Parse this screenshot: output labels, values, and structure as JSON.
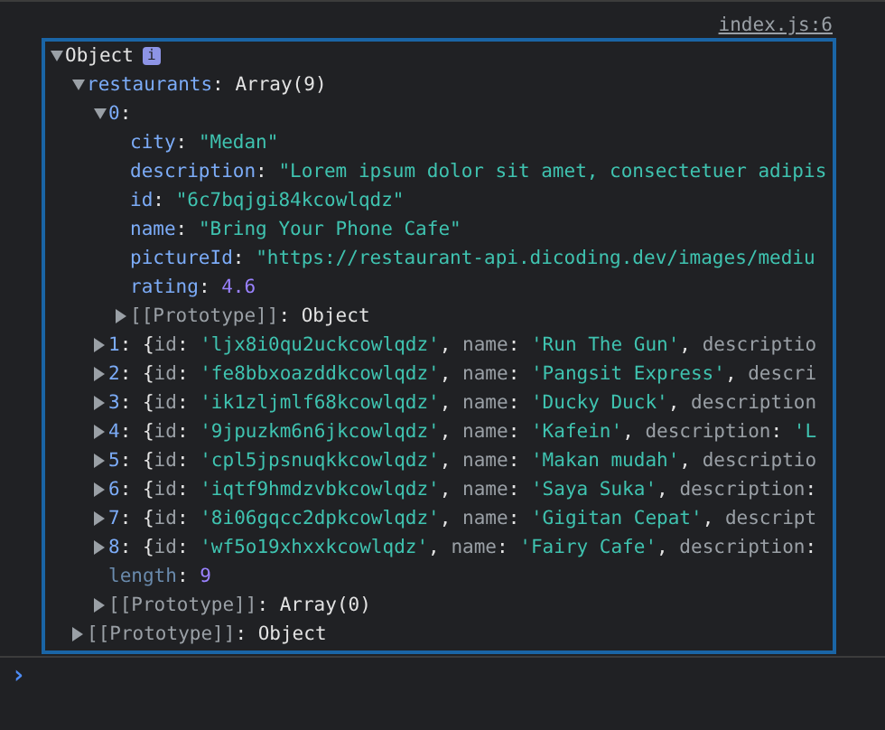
{
  "source_link": "index.js:6",
  "tree": {
    "expanded": true,
    "tokens": [
      {
        "kind": "type",
        "text": "Object"
      }
    ],
    "info_badge": "i",
    "children": [
      {
        "expanded": true,
        "tokens": [
          {
            "kind": "key",
            "text": "restaurants"
          },
          {
            "kind": "punct",
            "text": ": "
          },
          {
            "kind": "type",
            "text": "Array(9)"
          }
        ],
        "children": [
          {
            "expanded": true,
            "tokens": [
              {
                "kind": "key",
                "text": "0"
              },
              {
                "kind": "punct",
                "text": ":"
              }
            ],
            "children": [
              {
                "tokens": [
                  {
                    "kind": "key",
                    "text": "city"
                  },
                  {
                    "kind": "punct",
                    "text": ": "
                  },
                  {
                    "kind": "string",
                    "text": "\"Medan\""
                  }
                ]
              },
              {
                "tokens": [
                  {
                    "kind": "key",
                    "text": "description"
                  },
                  {
                    "kind": "punct",
                    "text": ": "
                  },
                  {
                    "kind": "string",
                    "text": "\"Lorem ipsum dolor sit amet, consectetuer adipis"
                  }
                ]
              },
              {
                "tokens": [
                  {
                    "kind": "key",
                    "text": "id"
                  },
                  {
                    "kind": "punct",
                    "text": ": "
                  },
                  {
                    "kind": "string",
                    "text": "\"6c7bqjgi84kcowlqdz\""
                  }
                ]
              },
              {
                "tokens": [
                  {
                    "kind": "key",
                    "text": "name"
                  },
                  {
                    "kind": "punct",
                    "text": ": "
                  },
                  {
                    "kind": "string",
                    "text": "\"Bring Your Phone Cafe\""
                  }
                ]
              },
              {
                "tokens": [
                  {
                    "kind": "key",
                    "text": "pictureId"
                  },
                  {
                    "kind": "punct",
                    "text": ": "
                  },
                  {
                    "kind": "string",
                    "text": "\"https://restaurant-api.dicoding.dev/images/mediu"
                  }
                ]
              },
              {
                "tokens": [
                  {
                    "kind": "key",
                    "text": "rating"
                  },
                  {
                    "kind": "punct",
                    "text": ": "
                  },
                  {
                    "kind": "number",
                    "text": "4.6"
                  }
                ]
              },
              {
                "expanded": false,
                "tokens": [
                  {
                    "kind": "internal",
                    "text": "[[Prototype]]"
                  },
                  {
                    "kind": "punct",
                    "text": ": "
                  },
                  {
                    "kind": "type",
                    "text": "Object"
                  }
                ]
              }
            ]
          },
          {
            "expanded": false,
            "tokens": [
              {
                "kind": "key",
                "text": "1"
              },
              {
                "kind": "punct",
                "text": ": {"
              },
              {
                "kind": "preview_key",
                "text": "id"
              },
              {
                "kind": "punct",
                "text": ": "
              },
              {
                "kind": "string",
                "text": "'ljx8i0qu2uckcowlqdz'"
              },
              {
                "kind": "punct",
                "text": ", "
              },
              {
                "kind": "preview_key",
                "text": "name"
              },
              {
                "kind": "punct",
                "text": ": "
              },
              {
                "kind": "string",
                "text": "'Run The Gun'"
              },
              {
                "kind": "punct",
                "text": ", "
              },
              {
                "kind": "preview_key",
                "text": "descriptio"
              }
            ]
          },
          {
            "expanded": false,
            "tokens": [
              {
                "kind": "key",
                "text": "2"
              },
              {
                "kind": "punct",
                "text": ": {"
              },
              {
                "kind": "preview_key",
                "text": "id"
              },
              {
                "kind": "punct",
                "text": ": "
              },
              {
                "kind": "string",
                "text": "'fe8bbxoazddkcowlqdz'"
              },
              {
                "kind": "punct",
                "text": ", "
              },
              {
                "kind": "preview_key",
                "text": "name"
              },
              {
                "kind": "punct",
                "text": ": "
              },
              {
                "kind": "string",
                "text": "'Pangsit Express'"
              },
              {
                "kind": "punct",
                "text": ", "
              },
              {
                "kind": "preview_key",
                "text": "descri"
              }
            ]
          },
          {
            "expanded": false,
            "tokens": [
              {
                "kind": "key",
                "text": "3"
              },
              {
                "kind": "punct",
                "text": ": {"
              },
              {
                "kind": "preview_key",
                "text": "id"
              },
              {
                "kind": "punct",
                "text": ": "
              },
              {
                "kind": "string",
                "text": "'ik1zljmlf68kcowlqdz'"
              },
              {
                "kind": "punct",
                "text": ", "
              },
              {
                "kind": "preview_key",
                "text": "name"
              },
              {
                "kind": "punct",
                "text": ": "
              },
              {
                "kind": "string",
                "text": "'Ducky Duck'"
              },
              {
                "kind": "punct",
                "text": ", "
              },
              {
                "kind": "preview_key",
                "text": "description"
              }
            ]
          },
          {
            "expanded": false,
            "tokens": [
              {
                "kind": "key",
                "text": "4"
              },
              {
                "kind": "punct",
                "text": ": {"
              },
              {
                "kind": "preview_key",
                "text": "id"
              },
              {
                "kind": "punct",
                "text": ": "
              },
              {
                "kind": "string",
                "text": "'9jpuzkm6n6jkcowlqdz'"
              },
              {
                "kind": "punct",
                "text": ", "
              },
              {
                "kind": "preview_key",
                "text": "name"
              },
              {
                "kind": "punct",
                "text": ": "
              },
              {
                "kind": "string",
                "text": "'Kafein'"
              },
              {
                "kind": "punct",
                "text": ", "
              },
              {
                "kind": "preview_key",
                "text": "description"
              },
              {
                "kind": "punct",
                "text": ": "
              },
              {
                "kind": "string",
                "text": "'L"
              }
            ]
          },
          {
            "expanded": false,
            "tokens": [
              {
                "kind": "key",
                "text": "5"
              },
              {
                "kind": "punct",
                "text": ": {"
              },
              {
                "kind": "preview_key",
                "text": "id"
              },
              {
                "kind": "punct",
                "text": ": "
              },
              {
                "kind": "string",
                "text": "'cpl5jpsnuqkkcowlqdz'"
              },
              {
                "kind": "punct",
                "text": ", "
              },
              {
                "kind": "preview_key",
                "text": "name"
              },
              {
                "kind": "punct",
                "text": ": "
              },
              {
                "kind": "string",
                "text": "'Makan mudah'"
              },
              {
                "kind": "punct",
                "text": ", "
              },
              {
                "kind": "preview_key",
                "text": "descriptio"
              }
            ]
          },
          {
            "expanded": false,
            "tokens": [
              {
                "kind": "key",
                "text": "6"
              },
              {
                "kind": "punct",
                "text": ": {"
              },
              {
                "kind": "preview_key",
                "text": "id"
              },
              {
                "kind": "punct",
                "text": ": "
              },
              {
                "kind": "string",
                "text": "'iqtf9hmdzvbkcowlqdz'"
              },
              {
                "kind": "punct",
                "text": ", "
              },
              {
                "kind": "preview_key",
                "text": "name"
              },
              {
                "kind": "punct",
                "text": ": "
              },
              {
                "kind": "string",
                "text": "'Saya Suka'"
              },
              {
                "kind": "punct",
                "text": ", "
              },
              {
                "kind": "preview_key",
                "text": "description"
              },
              {
                "kind": "punct",
                "text": ":"
              }
            ]
          },
          {
            "expanded": false,
            "tokens": [
              {
                "kind": "key",
                "text": "7"
              },
              {
                "kind": "punct",
                "text": ": {"
              },
              {
                "kind": "preview_key",
                "text": "id"
              },
              {
                "kind": "punct",
                "text": ": "
              },
              {
                "kind": "string",
                "text": "'8i06gqcc2dpkcowlqdz'"
              },
              {
                "kind": "punct",
                "text": ", "
              },
              {
                "kind": "preview_key",
                "text": "name"
              },
              {
                "kind": "punct",
                "text": ": "
              },
              {
                "kind": "string",
                "text": "'Gigitan Cepat'"
              },
              {
                "kind": "punct",
                "text": ", "
              },
              {
                "kind": "preview_key",
                "text": "descript"
              }
            ]
          },
          {
            "expanded": false,
            "tokens": [
              {
                "kind": "key",
                "text": "8"
              },
              {
                "kind": "punct",
                "text": ": {"
              },
              {
                "kind": "preview_key",
                "text": "id"
              },
              {
                "kind": "punct",
                "text": ": "
              },
              {
                "kind": "string",
                "text": "'wf5o19xhxxkcowlqdz'"
              },
              {
                "kind": "punct",
                "text": ", "
              },
              {
                "kind": "preview_key",
                "text": "name"
              },
              {
                "kind": "punct",
                "text": ": "
              },
              {
                "kind": "string",
                "text": "'Fairy Cafe'"
              },
              {
                "kind": "punct",
                "text": ", "
              },
              {
                "kind": "preview_key",
                "text": "description"
              },
              {
                "kind": "punct",
                "text": ":"
              }
            ]
          },
          {
            "tokens": [
              {
                "kind": "dim_key",
                "text": "length"
              },
              {
                "kind": "punct",
                "text": ": "
              },
              {
                "kind": "number",
                "text": "9"
              }
            ]
          },
          {
            "expanded": false,
            "tokens": [
              {
                "kind": "internal",
                "text": "[[Prototype]]"
              },
              {
                "kind": "punct",
                "text": ": "
              },
              {
                "kind": "type",
                "text": "Array(0)"
              }
            ]
          }
        ]
      },
      {
        "expanded": false,
        "tokens": [
          {
            "kind": "internal",
            "text": "[[Prototype]]"
          },
          {
            "kind": "punct",
            "text": ": "
          },
          {
            "kind": "type",
            "text": "Object"
          }
        ]
      }
    ]
  },
  "prompt": "›"
}
